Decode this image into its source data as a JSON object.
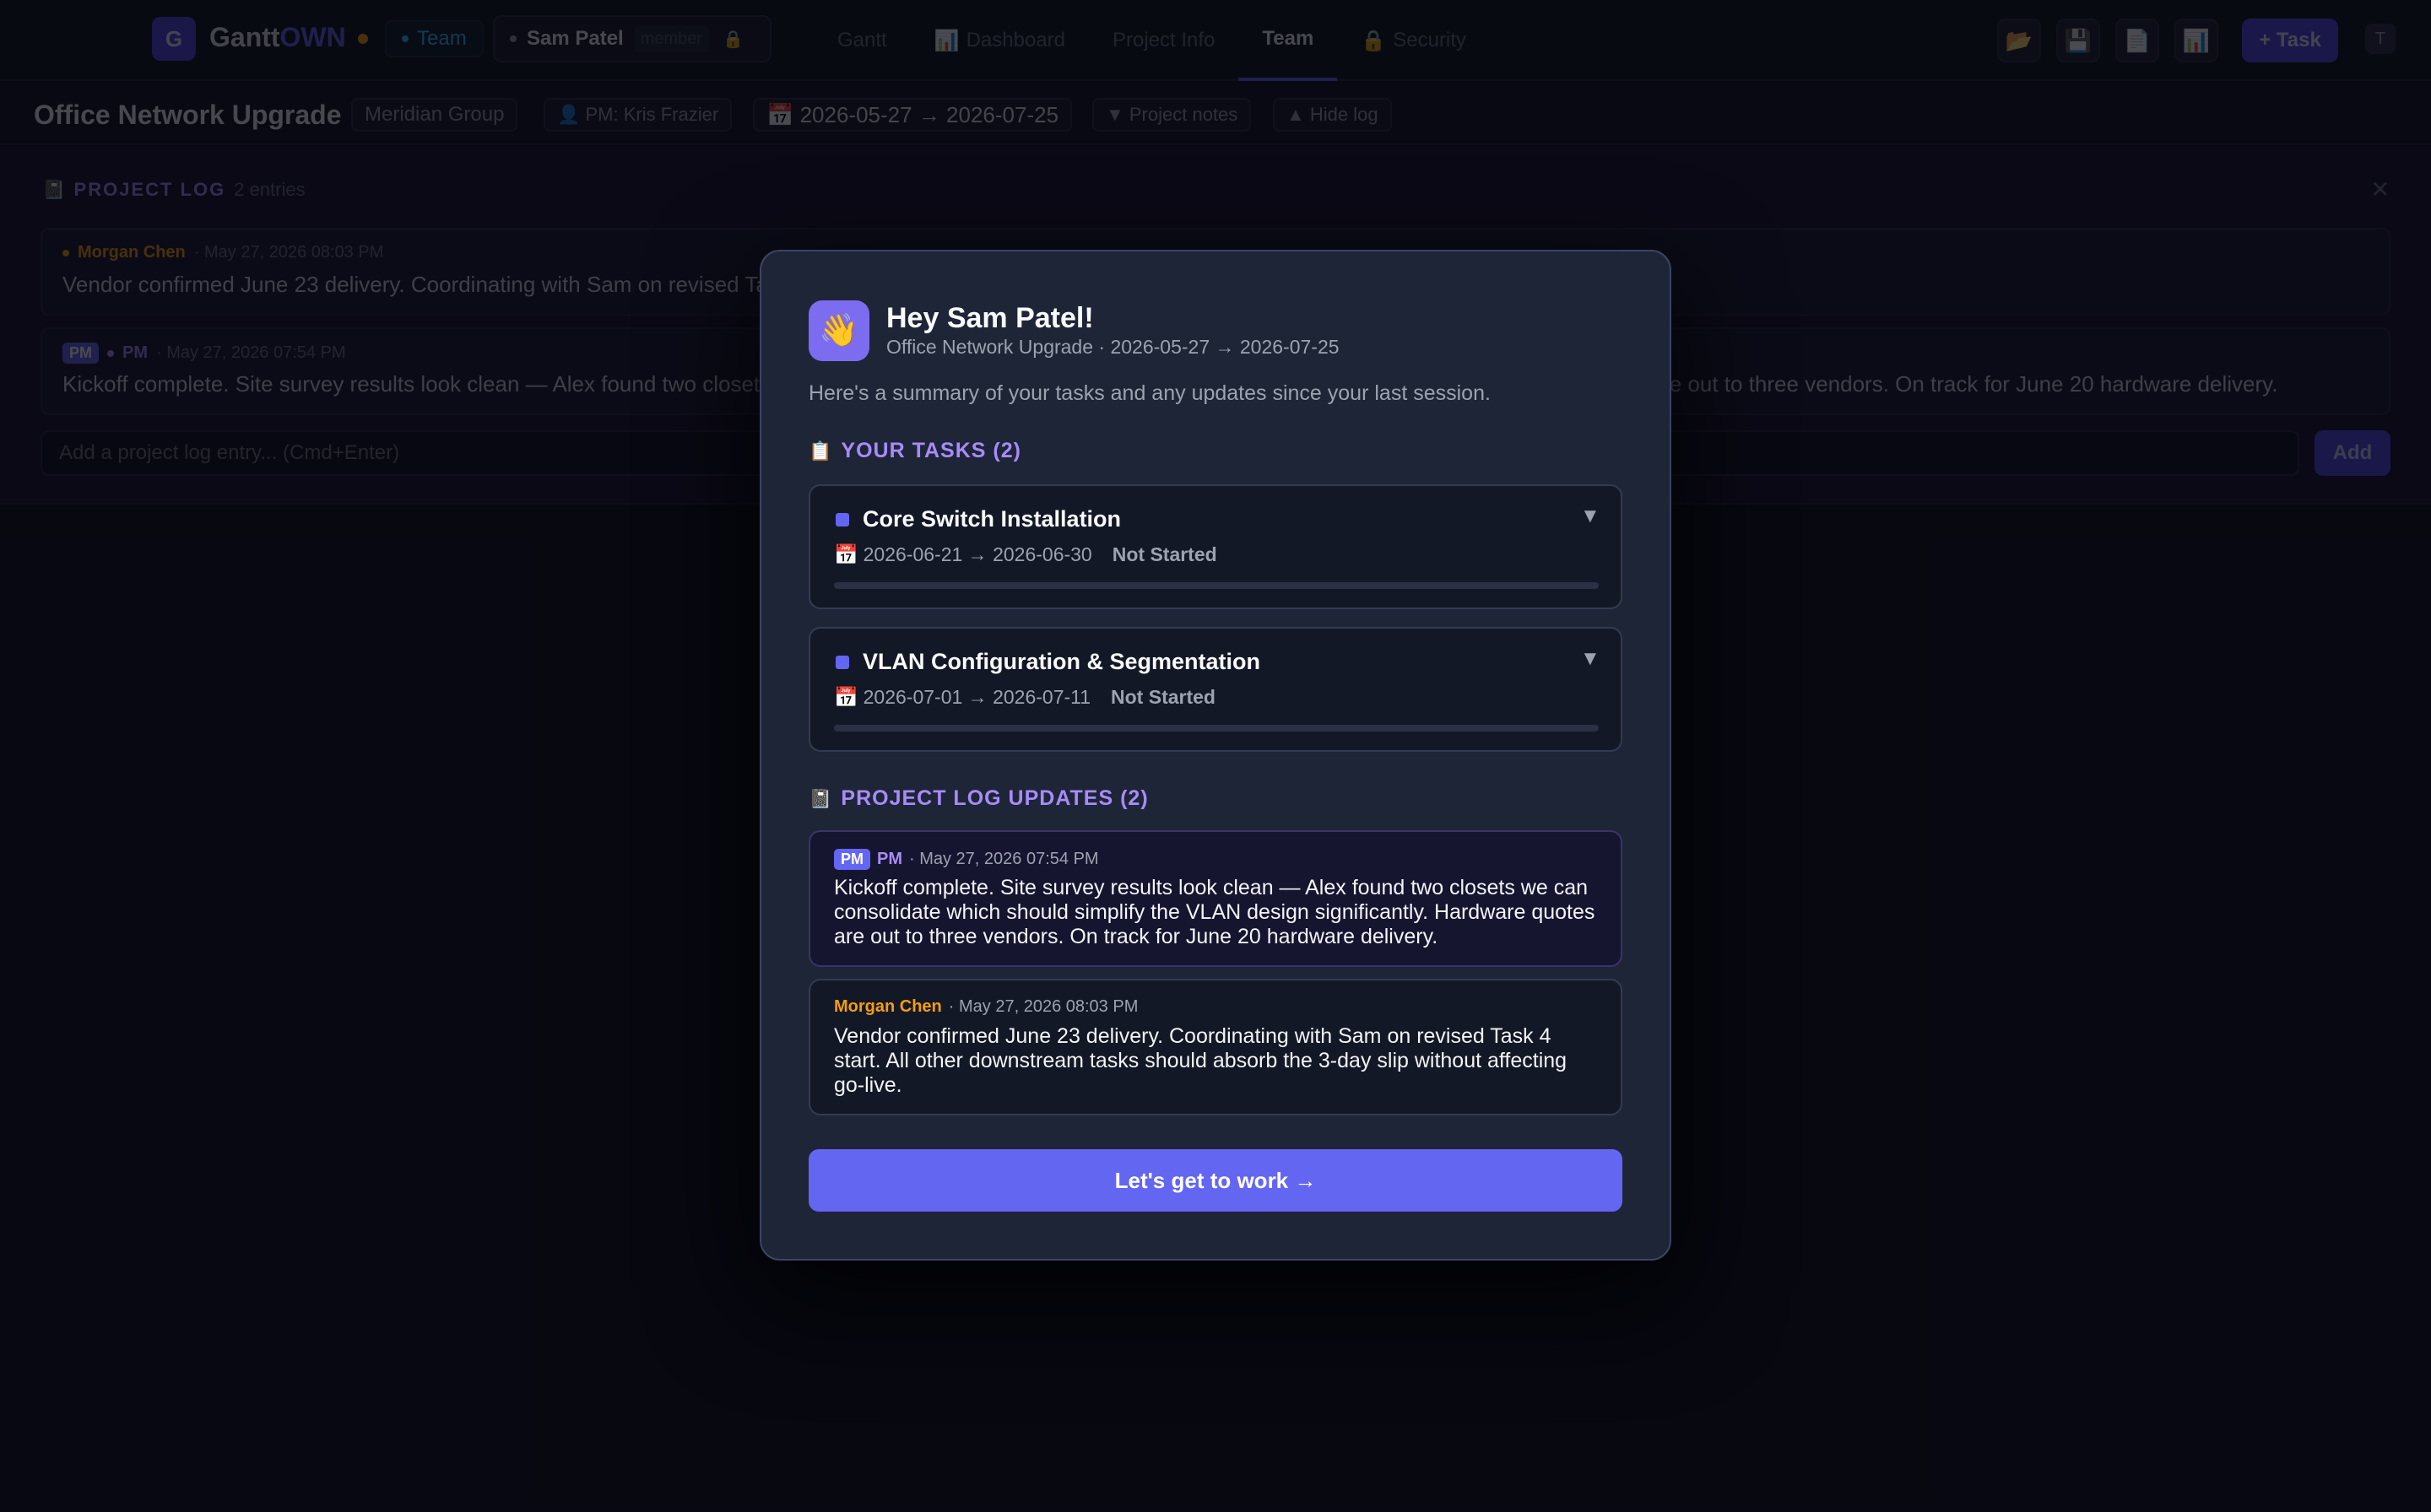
{
  "app": {
    "logo_letter": "G",
    "name_main": "Gantt",
    "name_accent": "OWN",
    "team_chip": "Team",
    "user": {
      "name": "Sam Patel",
      "role": "member",
      "lock_icon": "lock-icon"
    },
    "nav": [
      {
        "label": "Gantt",
        "icon": ""
      },
      {
        "label": "Dashboard",
        "icon": "📊"
      },
      {
        "label": "Project Info",
        "icon": ""
      },
      {
        "label": "Team",
        "icon": ""
      },
      {
        "label": "Security",
        "icon": "🔒"
      }
    ],
    "tools": [
      {
        "name": "open-folder-icon",
        "glyph": "📂"
      },
      {
        "name": "save-icon",
        "glyph": "💾"
      },
      {
        "name": "document-icon",
        "glyph": "📄"
      },
      {
        "name": "chart-icon",
        "glyph": "📊"
      }
    ],
    "add_task_label": "+ Task",
    "avatar_glyph": "T"
  },
  "project": {
    "title": "Office Network Upgrade",
    "client": "Meridian Group",
    "pm": "👤 PM: Kris Frazier",
    "dates": "📅 2026-05-27 → 2026-07-25",
    "notes_label": "▼ Project notes",
    "hide_log_label": "▲ Hide log"
  },
  "log": {
    "icon": "📓",
    "title": "PROJECT LOG",
    "count": "2 entries",
    "close_glyph": "✕",
    "entries": [
      {
        "author": "Morgan Chen",
        "time": "· May 27, 2026 08:03 PM",
        "text": "Vendor confirmed June 23 delivery. Coordinating with Sam on revised Task 4 start. All other downstream tasks should absorb the 3-day slip without affecting go-live."
      },
      {
        "badge": "PM",
        "author": "PM",
        "time": "· May 27, 2026 07:54 PM",
        "text": "Kickoff complete. Site survey results look clean — Alex found two closets we can consolidate which should simplify the VLAN design significantly. Hardware quotes are out to three vendors. On track for June 20 hardware delivery."
      }
    ],
    "input_placeholder": "Add a project log entry... (Cmd+Enter)",
    "add_label": "Add"
  },
  "modal": {
    "wave_glyph": "👋",
    "greeting": "Hey Sam Patel!",
    "subtitle": "Office Network Upgrade · 2026-05-27 → 2026-07-25",
    "summary": "Here's a summary of your tasks and any updates since your last session.",
    "tasks_title": "YOUR TASKS (2)",
    "tasks_icon": "📋",
    "tasks": [
      {
        "name": "Core Switch Installation",
        "dates": "2026-06-21 → 2026-06-30",
        "status": "Not Started",
        "progress": 0
      },
      {
        "name": "VLAN Configuration & Segmentation",
        "dates": "2026-07-01 → 2026-07-11",
        "status": "Not Started",
        "progress": 0
      }
    ],
    "calendar_glyph": "📅",
    "caret_glyph": "▼",
    "updates_title": "PROJECT LOG UPDATES (2)",
    "updates_icon": "📓",
    "updates": [
      {
        "badge": "PM",
        "author": "PM",
        "time": "· May 27, 2026 07:54 PM",
        "text": "Kickoff complete. Site survey results look clean — Alex found two closets we can consolidate which should simplify the VLAN design significantly. Hardware quotes are out to three vendors. On track for June 20 hardware delivery."
      },
      {
        "author": "Morgan Chen",
        "time": "· May 27, 2026 08:03 PM",
        "text": "Vendor confirmed June 23 delivery. Coordinating with Sam on revised Task 4 start. All other downstream tasks should absorb the 3-day slip without affecting go-live."
      }
    ],
    "cta_label": "Let's get to work →"
  },
  "colors": {
    "accent": "#6366f1",
    "accent_light": "#a78bfa",
    "warning": "#f59e0b",
    "modal_bg": "#1e2536",
    "page_bg": "#0a0b14"
  }
}
